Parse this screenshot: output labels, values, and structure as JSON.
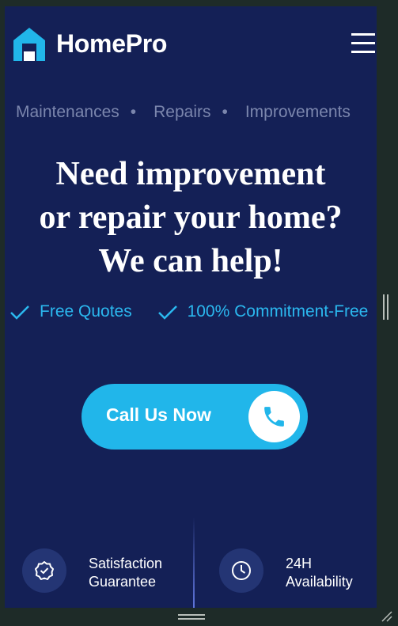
{
  "header": {
    "brand": "HomePro",
    "logo_icon": "house-logo-icon",
    "menu_icon": "hamburger-menu-icon"
  },
  "services": [
    "Maintenances",
    "Repairs",
    "Improvements"
  ],
  "services_separator": "•",
  "headline": {
    "line1": "Need improvement",
    "line2": "or repair your home?",
    "line3": "We can help!"
  },
  "features": [
    {
      "label": "Free Quotes",
      "icon": "check-icon"
    },
    {
      "label": "100% Commitment-Free",
      "icon": "check-icon"
    }
  ],
  "cta": {
    "label": "Call Us Now",
    "icon": "phone-icon"
  },
  "badges": [
    {
      "line1": "Satisfaction",
      "line2": "Guarantee",
      "icon": "badge-check-icon"
    },
    {
      "line1": "24H",
      "line2": "Availability",
      "icon": "clock-icon"
    }
  ],
  "colors": {
    "background": "#142056",
    "accent": "#21b6ea",
    "muted_text": "#7b86ad",
    "badge_circle": "#243574",
    "outer_frame": "#1e2b28"
  }
}
